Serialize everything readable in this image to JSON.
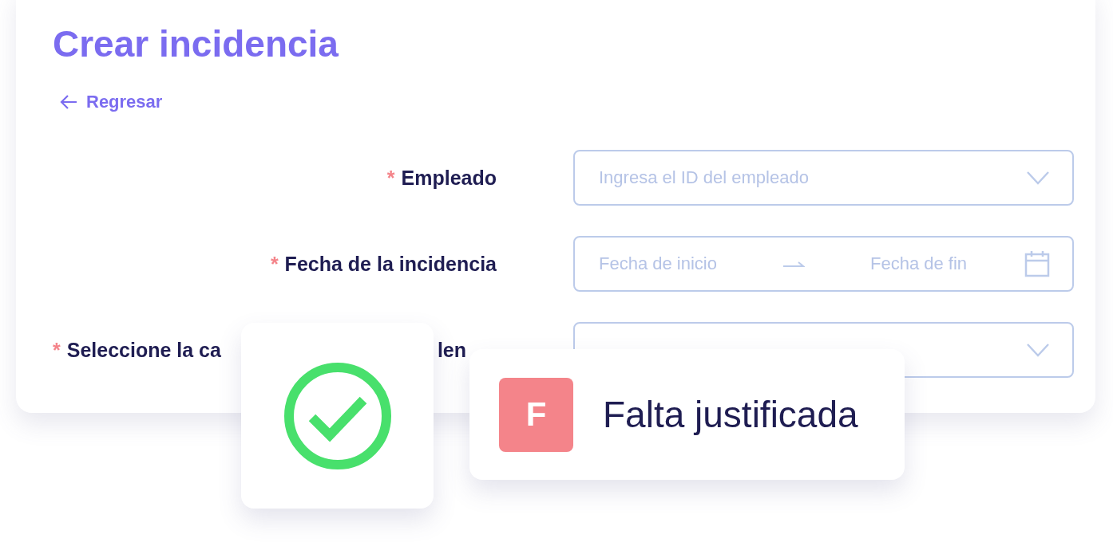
{
  "title": "Crear incidencia",
  "back_link": {
    "label": "Regresar"
  },
  "fields": [
    {
      "kind": "select",
      "marker": "*",
      "label": "Empleado",
      "placeholder": "Ingresa el ID del empleado"
    },
    {
      "kind": "daterange",
      "marker": "*",
      "label": "Fecha de la incidencia",
      "start_placeholder": "Fecha de inicio",
      "end_placeholder": "Fecha de fin"
    },
    {
      "kind": "select",
      "marker": "*",
      "label_start": "Seleccione la ca",
      "label_end": "len"
    }
  ],
  "status_card": {
    "kind": "success"
  },
  "tag_card": {
    "badge": "F",
    "label": "Falta justificada",
    "color": "#f4848a"
  }
}
